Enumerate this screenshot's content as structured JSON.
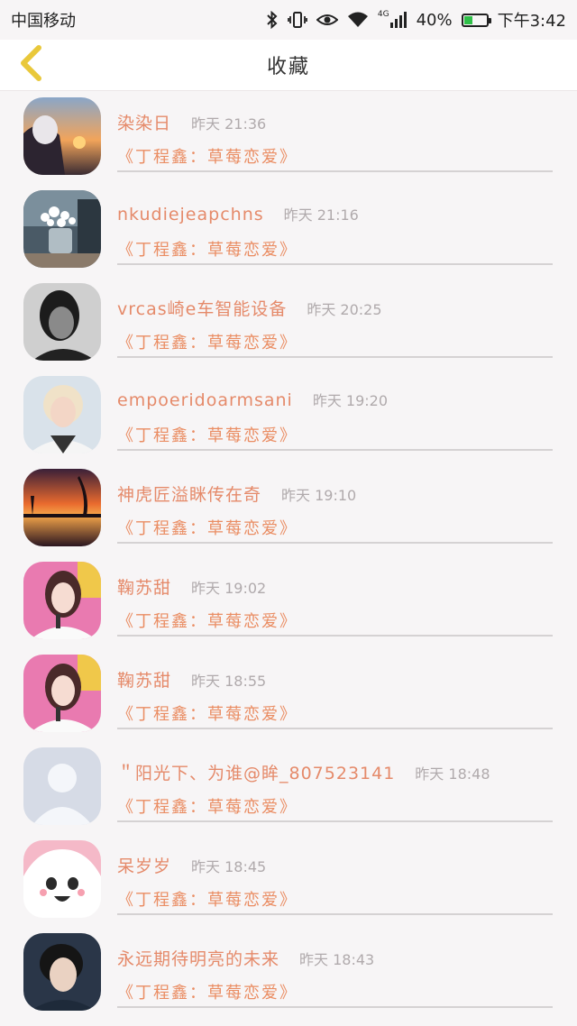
{
  "status_bar": {
    "carrier": "中国移动",
    "battery_percent": "40%",
    "battery_level": 0.4,
    "network": "4G",
    "time": "下午3:42",
    "icons": [
      "bluetooth-icon",
      "vibrate-icon",
      "eye-icon",
      "wifi-icon",
      "signal-icon",
      "battery-icon"
    ]
  },
  "header": {
    "title": "收藏",
    "back_icon": "chevron-left-icon"
  },
  "favorites": [
    {
      "user": "染染日",
      "time": "昨天 21:36",
      "title": "《丁程鑫：草莓恋爱》",
      "avatar": "sunset-portrait"
    },
    {
      "user": "nkudiejeapchns",
      "time": "昨天 21:16",
      "title": "《丁程鑫：草莓恋爱》",
      "avatar": "flowers-vase"
    },
    {
      "user": "vrcas崎e车智能设备",
      "time": "昨天 20:25",
      "title": "《丁程鑫：草莓恋爱》",
      "avatar": "dark-portrait"
    },
    {
      "user": "empoeridoarmsani",
      "time": "昨天 19:20",
      "title": "《丁程鑫：草莓恋爱》",
      "avatar": "blond-portrait"
    },
    {
      "user": "神虎匠溢眯传在奇",
      "time": "昨天 19:10",
      "title": "《丁程鑫：草莓恋爱》",
      "avatar": "sunset-lake"
    },
    {
      "user": "鞠苏甜",
      "time": "昨天 19:02",
      "title": "《丁程鑫：草莓恋爱》",
      "avatar": "pink-portrait"
    },
    {
      "user": "鞠苏甜",
      "time": "昨天 18:55",
      "title": "《丁程鑫：草莓恋爱》",
      "avatar": "pink-portrait"
    },
    {
      "user": "＂阳光下、为谁@眸_807523141",
      "time": "昨天 18:48",
      "title": "《丁程鑫：草莓恋爱》",
      "avatar": "default-avatar"
    },
    {
      "user": "呆岁岁",
      "time": "昨天 18:45",
      "title": "《丁程鑫：草莓恋爱》",
      "avatar": "anime-girl"
    },
    {
      "user": "永远期待明亮的未来",
      "time": "昨天 18:43",
      "title": "《丁程鑫：草莓恋爱》",
      "avatar": "dark-hair-portrait"
    }
  ],
  "colors": {
    "accent_name": "#e58a6a",
    "accent_title": "#ea8d63",
    "back_icon": "#e9c83a",
    "time": "#b0aaac"
  }
}
